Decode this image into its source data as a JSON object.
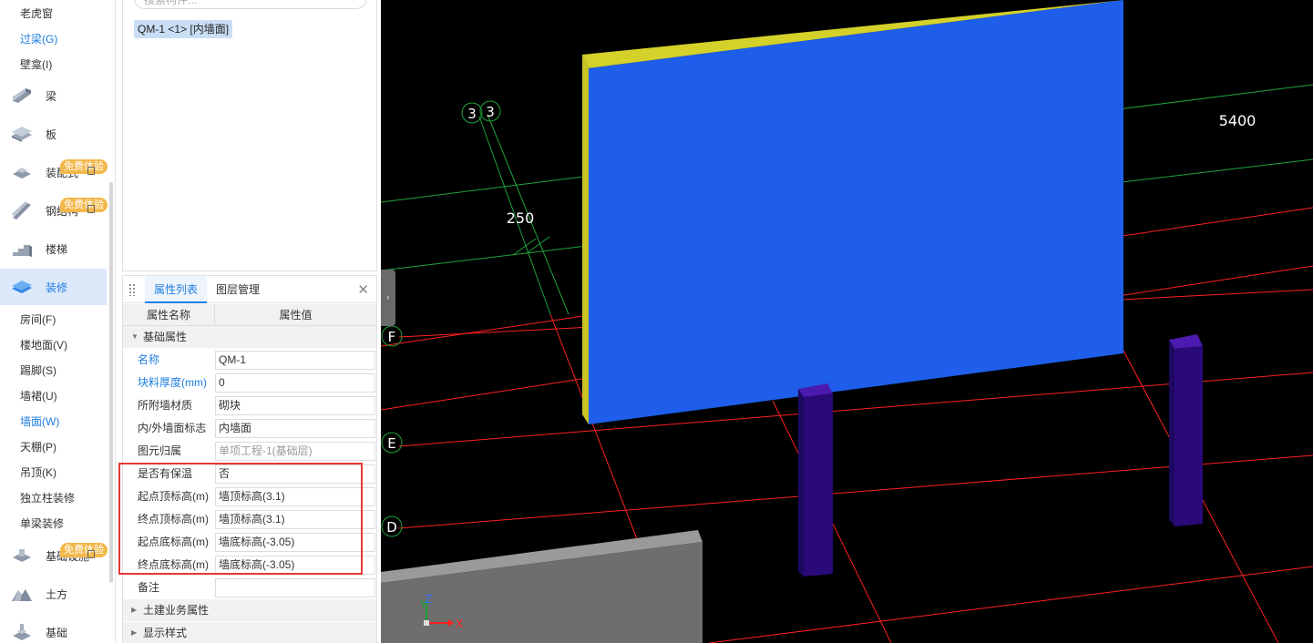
{
  "nav": {
    "top_items": [
      {
        "label": "老虎窗"
      },
      {
        "label": "过梁(G)",
        "active": true
      },
      {
        "label": "壁龛(I)"
      }
    ],
    "categories_a": [
      {
        "label": "梁",
        "icon": "beam-icon"
      },
      {
        "label": "板",
        "icon": "slab-icon"
      },
      {
        "label": "装配式",
        "icon": "prefab-icon",
        "badge": "免费体验"
      },
      {
        "label": "钢结构",
        "icon": "steel-icon",
        "badge": "免费体验"
      },
      {
        "label": "楼梯",
        "icon": "stairs-icon"
      },
      {
        "label": "装修",
        "icon": "decoration-icon",
        "active": true
      }
    ],
    "sub_items": [
      {
        "label": "房间(F)"
      },
      {
        "label": "楼地面(V)"
      },
      {
        "label": "踢脚(S)"
      },
      {
        "label": "墙裙(U)"
      },
      {
        "label": "墙面(W)",
        "active": true
      },
      {
        "label": "天棚(P)"
      },
      {
        "label": "吊顶(K)"
      },
      {
        "label": "独立柱装修"
      },
      {
        "label": "单梁装修"
      }
    ],
    "categories_b": [
      {
        "label": "基础设施",
        "icon": "foundation-infra-icon",
        "badge": "免费体验"
      },
      {
        "label": "土方",
        "icon": "earthwork-icon"
      },
      {
        "label": "基础",
        "icon": "foundation-icon"
      }
    ]
  },
  "component_panel": {
    "search_placeholder": "搜索构件...",
    "selected_item": "QM-1 <1> [内墙面]"
  },
  "property_panel": {
    "tabs": [
      "属性列表",
      "图层管理"
    ],
    "active_tab": 0,
    "columns": [
      "属性名称",
      "属性值"
    ],
    "groups": {
      "basic": "基础属性",
      "civil": "土建业务属性",
      "display": "显示样式"
    },
    "rows": [
      {
        "name": "名称",
        "value": "QM-1",
        "blue": true
      },
      {
        "name": "块料厚度(mm)",
        "value": "0",
        "blue": true
      },
      {
        "name": "所附墙材质",
        "value": "砌块"
      },
      {
        "name": "内/外墙面标志",
        "value": "内墙面"
      },
      {
        "name": "图元归属",
        "value": "单项工程-1(基础层)",
        "gray": true
      },
      {
        "name": "是否有保温",
        "value": "否"
      },
      {
        "name": "起点顶标高(m)",
        "value": "墙顶标高(3.1)"
      },
      {
        "name": "终点顶标高(m)",
        "value": "墙顶标高(3.1)"
      },
      {
        "name": "起点底标高(m)",
        "value": "墙底标高(-3.05)"
      },
      {
        "name": "终点底标高(m)",
        "value": "墙底标高(-3.05)"
      },
      {
        "name": "备注",
        "value": ""
      }
    ]
  },
  "viewport": {
    "axis_labels": [
      "3",
      "3",
      "F",
      "E",
      "D"
    ],
    "dimensions": [
      "250",
      "5400"
    ],
    "gizmo": {
      "x": "X",
      "y": "Y",
      "z": "Z"
    },
    "colors": {
      "wall_face": "#1e5eea",
      "wall_top": "#d4d12a",
      "column": "#2a0a78",
      "grid_red": "#ff2020",
      "grid_green": "#1fa23a"
    }
  }
}
